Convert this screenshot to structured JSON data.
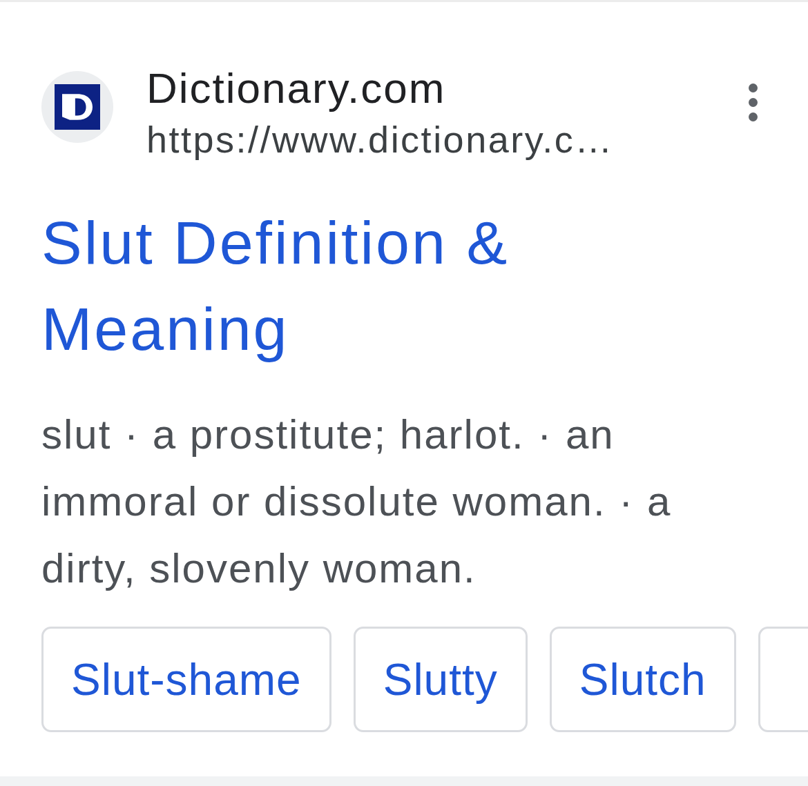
{
  "result": {
    "site_name": "Dictionary.com",
    "url": "https://www.dictionary.c…",
    "title": "Slut Definition & Meaning",
    "snippet": "slut · a prostitute; harlot. · an immoral or dissolute woman. · a dirty, slovenly woman.",
    "chips": [
      {
        "kind": "chip",
        "label": "Slut-shame"
      },
      {
        "kind": "chip",
        "label": "Slutty"
      },
      {
        "kind": "chip",
        "label": "Slutch"
      },
      {
        "kind": "cut"
      }
    ]
  }
}
